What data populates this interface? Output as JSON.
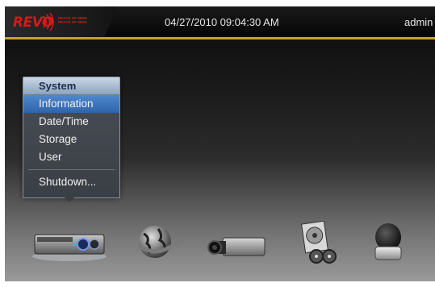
{
  "header": {
    "logo_text": "REVO",
    "logo_tagline": "PEACE OF MIND PEACE OF MIND",
    "datetime": "04/27/2010  09:04:30 AM",
    "user": "admin"
  },
  "menu": {
    "title": "System",
    "items": [
      {
        "label": "Information",
        "selected": true
      },
      {
        "label": "Date/Time",
        "selected": false
      },
      {
        "label": "Storage",
        "selected": false
      },
      {
        "label": "User",
        "selected": false
      }
    ],
    "footer_item": "Shutdown..."
  },
  "dock": {
    "icons": [
      "dvr-system-icon",
      "network-globe-icon",
      "camera-icon",
      "media-playback-icon",
      "ptz-dome-camera-icon"
    ],
    "active": "dvr-system-icon"
  },
  "colors": {
    "accent_bar": "#c9a227",
    "logo_red": "#d41a1a",
    "menu_selected": "#3a74bd",
    "menu_title": "#1b2f4d"
  }
}
